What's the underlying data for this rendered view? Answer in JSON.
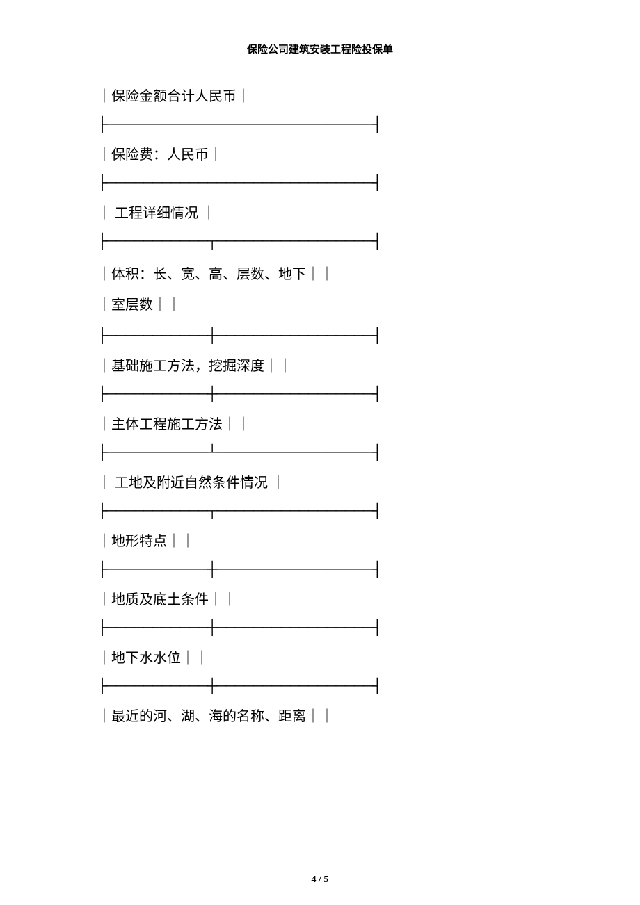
{
  "header": {
    "title": "保险公司建筑安装工程险投保单"
  },
  "rows": {
    "r1": "｜保险金额合计人民币｜",
    "r2": "｜保险费：人民币｜",
    "r3": "｜ 工程详细情况 ｜",
    "r4a": "｜体积：长、宽、高、层数、地下｜｜",
    "r4b": "｜室层数｜｜",
    "r5": "｜基础施工方法，挖掘深度｜｜",
    "r6": "｜主体工程施工方法｜｜",
    "r7": "｜ 工地及附近自然条件情况 ｜",
    "r8": "｜地形特点｜｜",
    "r9": "｜地质及底土条件｜｜",
    "r10": "｜地下水水位｜｜",
    "r11": "｜最近的河、湖、海的名称、距离｜｜"
  },
  "dividers": {
    "full": "├─────────────────────────────┤",
    "split": "├───────────┼─────────────────┤",
    "split_up": "├───────────┴─────────────────┤",
    "split_down": "├───────────┬─────────────────┤"
  },
  "footer": {
    "page": "4 / 5"
  }
}
